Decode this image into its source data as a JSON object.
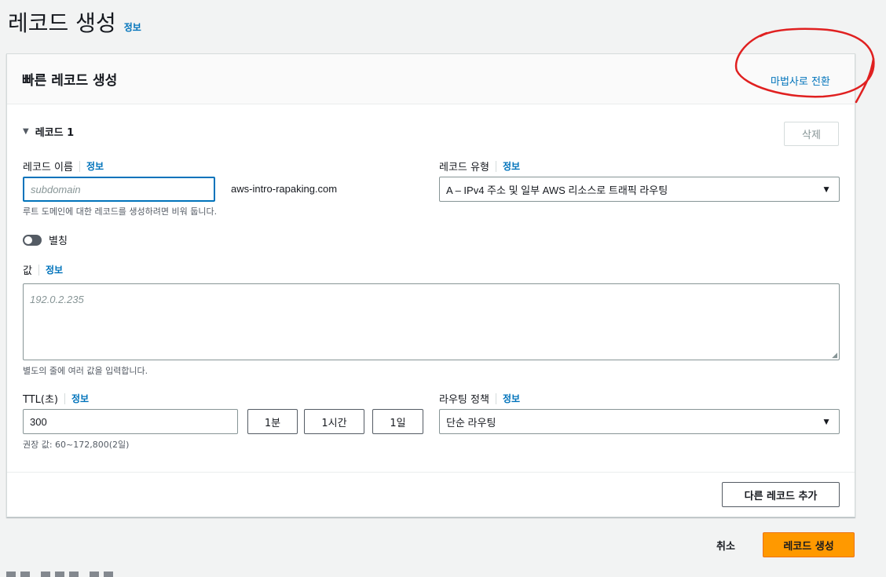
{
  "page": {
    "title": "레코드 생성",
    "info_link": "정보"
  },
  "panel": {
    "title": "빠른 레코드 생성",
    "switch_wizard": "마법사로 전환"
  },
  "record": {
    "section_title": "레코드 1",
    "delete_label": "삭제",
    "name": {
      "label": "레코드 이름",
      "info": "정보",
      "placeholder": "subdomain",
      "domain_suffix": "aws-intro-rapaking.com",
      "hint": "루트 도메인에 대한 레코드를 생성하려면 비워 둡니다."
    },
    "type": {
      "label": "레코드 유형",
      "info": "정보",
      "selected": "A – IPv4 주소 및 일부 AWS 리소스로 트래픽 라우팅"
    },
    "alias": {
      "label": "별칭",
      "enabled": false
    },
    "value": {
      "label": "값",
      "info": "정보",
      "placeholder": "192.0.2.235",
      "hint": "별도의 줄에 여러 값을 입력합니다."
    },
    "ttl": {
      "label": "TTL(초)",
      "info": "정보",
      "value": "300",
      "presets": [
        "1분",
        "1시간",
        "1일"
      ],
      "hint": "권장 값: 60~172,800(2일)"
    },
    "routing": {
      "label": "라우팅 정책",
      "info": "정보",
      "selected": "단순 라우팅"
    }
  },
  "add_record_label": "다른 레코드 추가",
  "footer": {
    "cancel_label": "취소",
    "create_label": "레코드 생성"
  },
  "colors": {
    "primary_button": "#ff9900",
    "link": "#0073bb",
    "annotation": "#e02020"
  }
}
